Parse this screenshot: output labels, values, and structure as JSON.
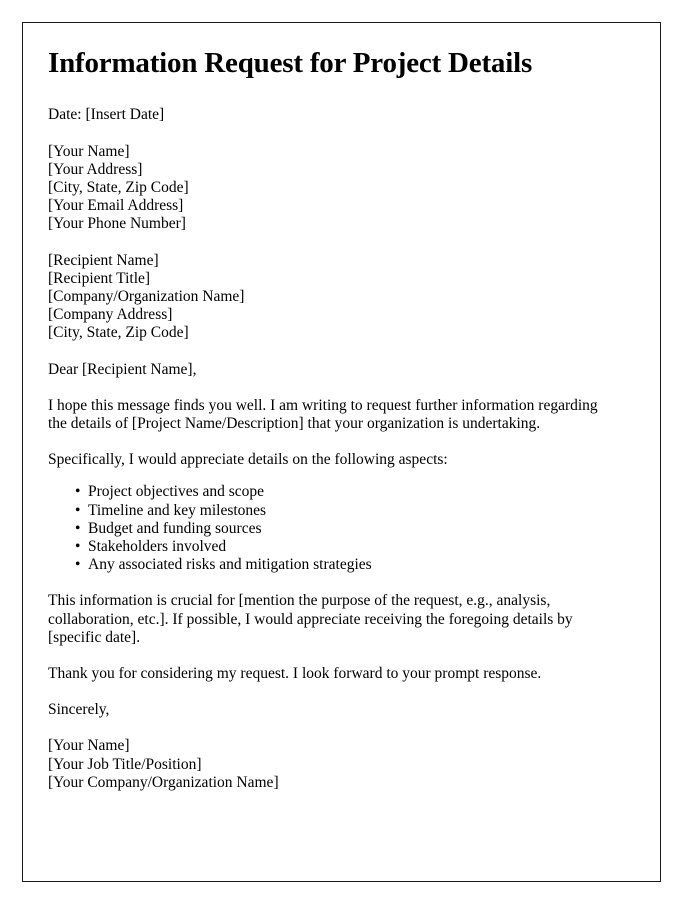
{
  "document": {
    "title": "Information Request for Project Details",
    "date_line": "Date: [Insert Date]",
    "sender_block": [
      "[Your Name]",
      "[Your Address]",
      "[City, State, Zip Code]",
      "[Your Email Address]",
      "[Your Phone Number]"
    ],
    "recipient_block": [
      "[Recipient Name]",
      "[Recipient Title]",
      "[Company/Organization Name]",
      "[Company Address]",
      "[City, State, Zip Code]"
    ],
    "salutation": "Dear [Recipient Name],",
    "paragraph_intro": "I hope this message finds you well. I am writing to request further information regarding the details of [Project Name/Description] that your organization is undertaking.",
    "paragraph_specifics": "Specifically, I would appreciate details on the following aspects:",
    "bullets": [
      "Project objectives and scope",
      "Timeline and key milestones",
      "Budget and funding sources",
      "Stakeholders involved",
      "Any associated risks and mitigation strategies"
    ],
    "paragraph_purpose": "This information is crucial for [mention the purpose of the request, e.g., analysis, collaboration, etc.]. If possible, I would appreciate receiving the foregoing details by [specific date].",
    "paragraph_thanks": "Thank you for considering my request. I look forward to your prompt response.",
    "closing": "Sincerely,",
    "signature_block": [
      "[Your Name]",
      "[Your Job Title/Position]",
      "[Your Company/Organization Name]"
    ]
  },
  "style": {
    "text_color": "#000000",
    "page_background": "#ffffff",
    "border_color": "#1a1a1a"
  }
}
